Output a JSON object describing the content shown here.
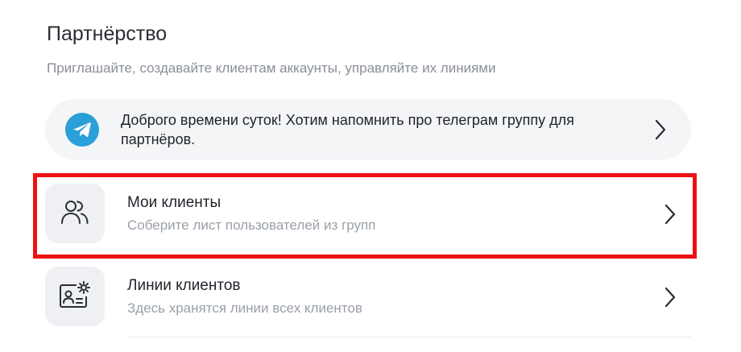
{
  "page": {
    "title": "Партнёрство",
    "subtitle": "Приглашайте, создавайте клиентам аккаунты, управляйте их линиями"
  },
  "banner": {
    "icon": "telegram-icon",
    "text": "Доброго времени суток! Хотим напомнить про телеграм группу для партнёров.",
    "chevron_icon": "chevron-right-icon",
    "background_color": "#f4f5f7",
    "icon_color": "#2a9fd8"
  },
  "items": [
    {
      "icon": "users-icon",
      "title": "Мои клиенты",
      "subtitle": "Соберите лист пользователей из групп",
      "chevron_icon": "chevron-right-icon",
      "highlighted": true
    },
    {
      "icon": "id-card-settings-icon",
      "title": "Линии клиентов",
      "subtitle": "Здесь хранятся линии всех клиентов",
      "chevron_icon": "chevron-right-icon"
    }
  ],
  "colors": {
    "highlight_border": "#ee1111",
    "text_primary": "#1f2329",
    "text_secondary": "#9aa0a8",
    "icon_tile": "#eef0f3"
  }
}
